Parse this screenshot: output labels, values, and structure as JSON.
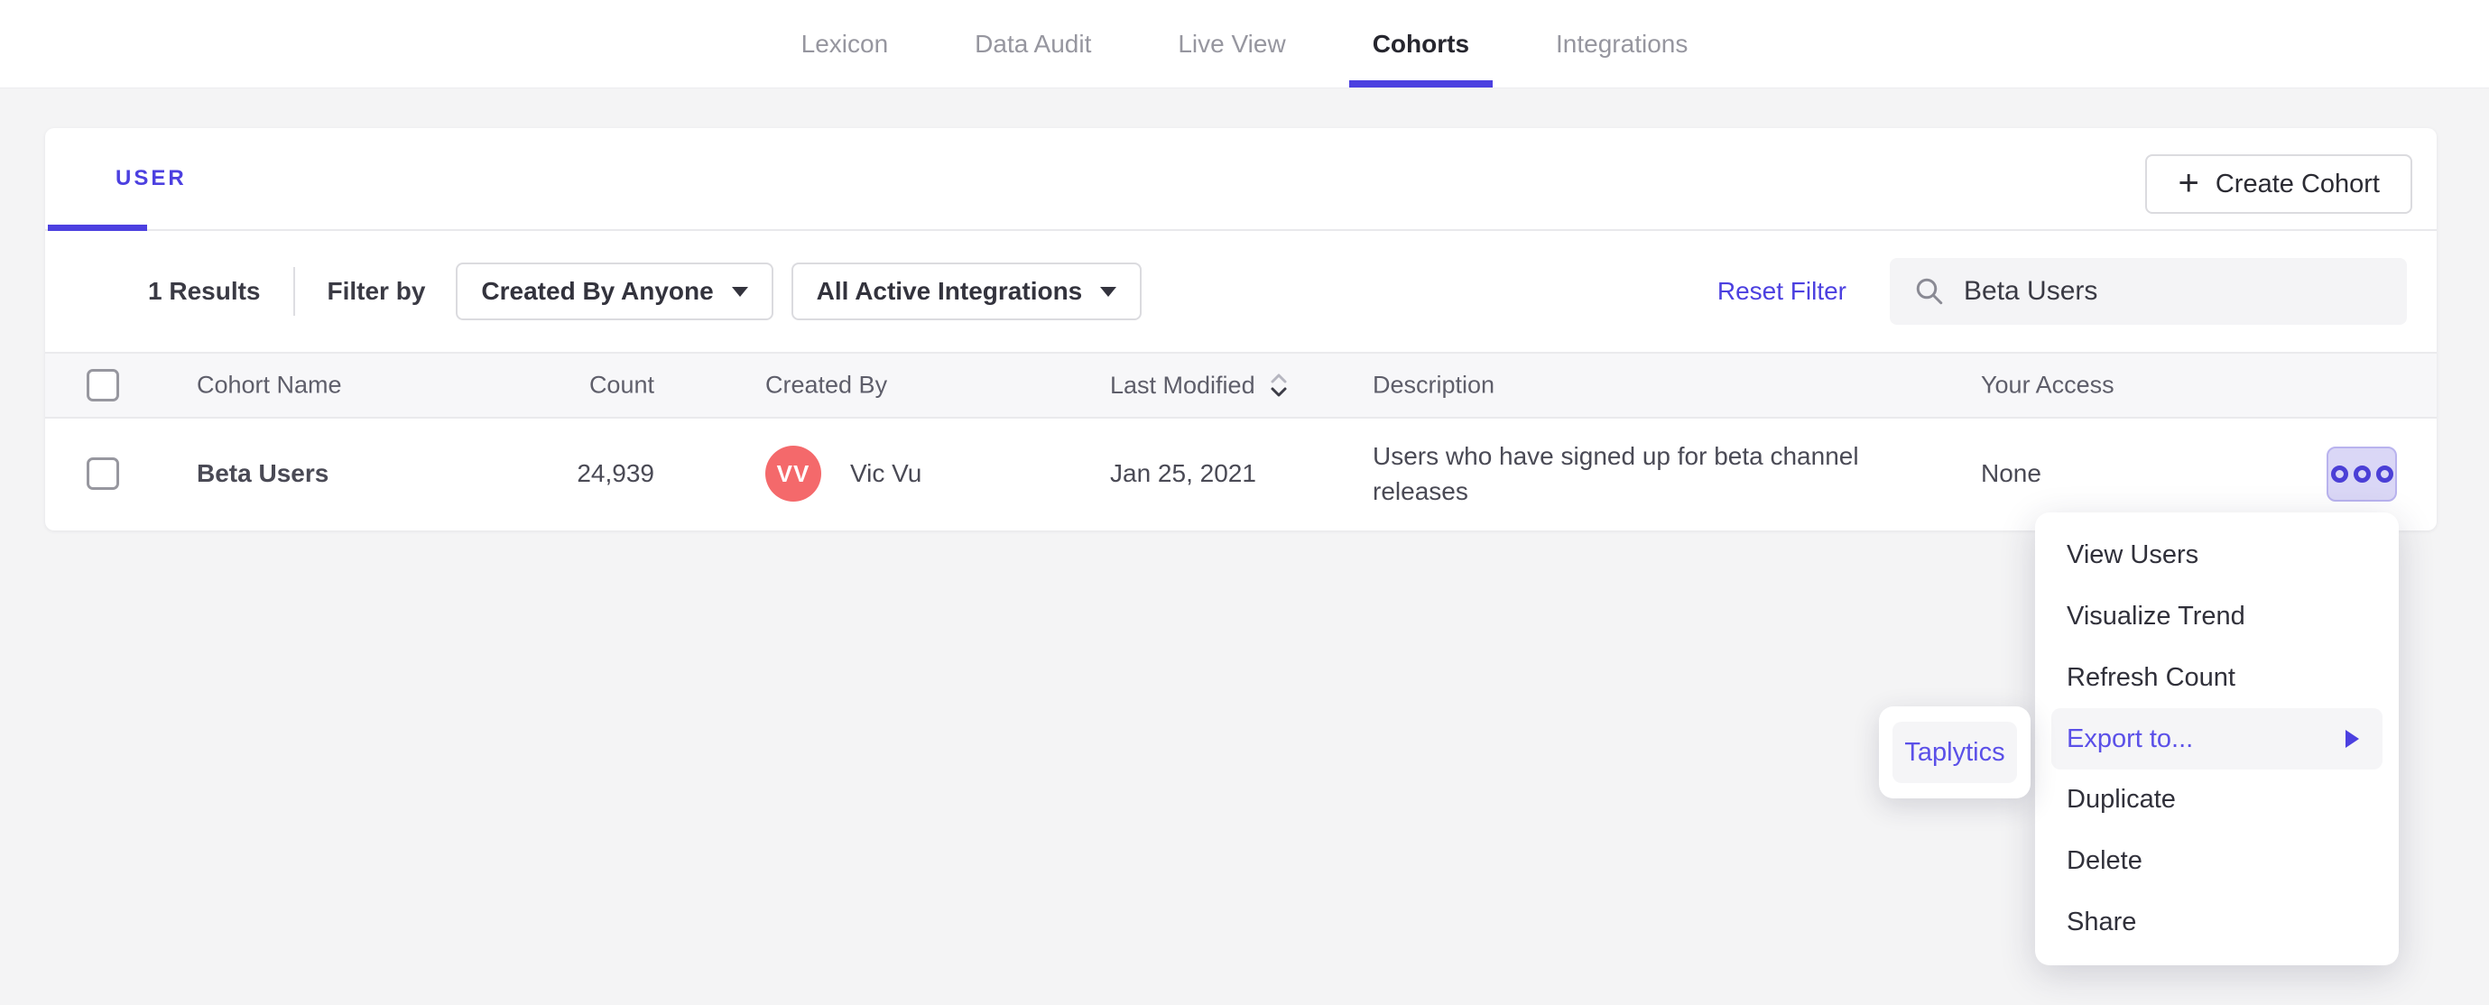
{
  "nav": {
    "items": [
      {
        "label": "Lexicon",
        "active": false
      },
      {
        "label": "Data Audit",
        "active": false
      },
      {
        "label": "Live View",
        "active": false
      },
      {
        "label": "Cohorts",
        "active": true
      },
      {
        "label": "Integrations",
        "active": false
      }
    ]
  },
  "cohorts_card": {
    "tab_label": "USER",
    "create_button_label": "Create Cohort",
    "filters": {
      "results": "1 Results",
      "filter_by": "Filter by",
      "created_by_dropdown": "Created By Anyone",
      "integrations_dropdown": "All Active Integrations",
      "reset": "Reset Filter",
      "search_value": "Beta Users"
    },
    "table": {
      "headers": {
        "name": "Cohort Name",
        "count": "Count",
        "created_by": "Created By",
        "last_modified": "Last Modified",
        "description": "Description",
        "access": "Your Access"
      },
      "row": {
        "name": "Beta Users",
        "count": "24,939",
        "avatar_initials": "VV",
        "created_by": "Vic Vu",
        "last_modified": "Jan 25, 2021",
        "description": "Users who have signed up for beta channel releases",
        "access": "None"
      }
    }
  },
  "context_menu": {
    "items": [
      {
        "label": "View Users"
      },
      {
        "label": "Visualize Trend"
      },
      {
        "label": "Refresh Count"
      },
      {
        "label": "Export to...",
        "highlighted": true,
        "has_submenu": true
      },
      {
        "label": "Duplicate"
      },
      {
        "label": "Delete"
      },
      {
        "label": "Share"
      }
    ]
  },
  "export_submenu": {
    "items": [
      {
        "label": "Taplytics"
      }
    ]
  },
  "colors": {
    "accent": "#4C40E0",
    "avatar_bg": "#F4696B",
    "more_button_bg": "#DAD7F6",
    "more_button_border": "#B9B3EE",
    "menu_highlight_bg": "#F5F5F7",
    "page_bg": "#F4F4F5"
  }
}
